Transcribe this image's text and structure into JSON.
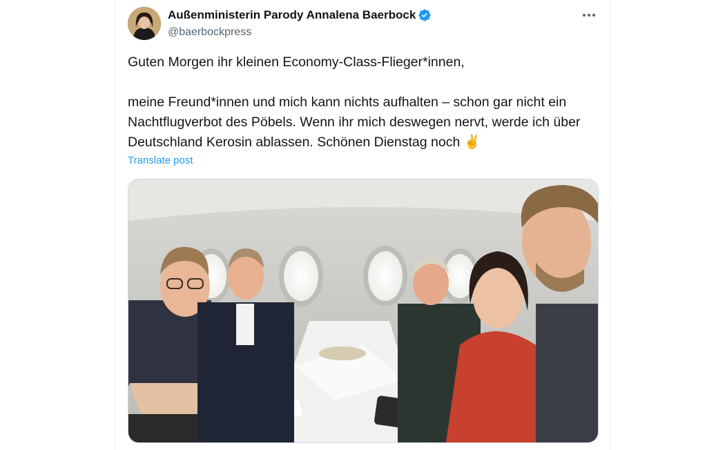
{
  "post": {
    "author_name": "Außenministerin Parody Annalena Baerbock",
    "handle": "@baerbockpress",
    "text": "Guten Morgen ihr kleinen Economy-Class-Flieger*innen,\n\nmeine Freund*innen und mich kann nichts aufhalten – schon gar nicht ein Nachtflugverbot des Pöbels. Wenn ihr mich deswegen nervt, werde ich über Deutschland Kerosin ablassen. Schönen Dienstag noch ✌️",
    "translate_label": "Translate post",
    "media_alt": "Group selfie inside an airplane cabin",
    "icons": {
      "verified": "verified-badge-icon",
      "more": "more-options-icon"
    }
  },
  "colors": {
    "accent": "#1d9bf0",
    "text": "#0f1419",
    "secondary": "#536471",
    "border": "#cfd9de"
  }
}
